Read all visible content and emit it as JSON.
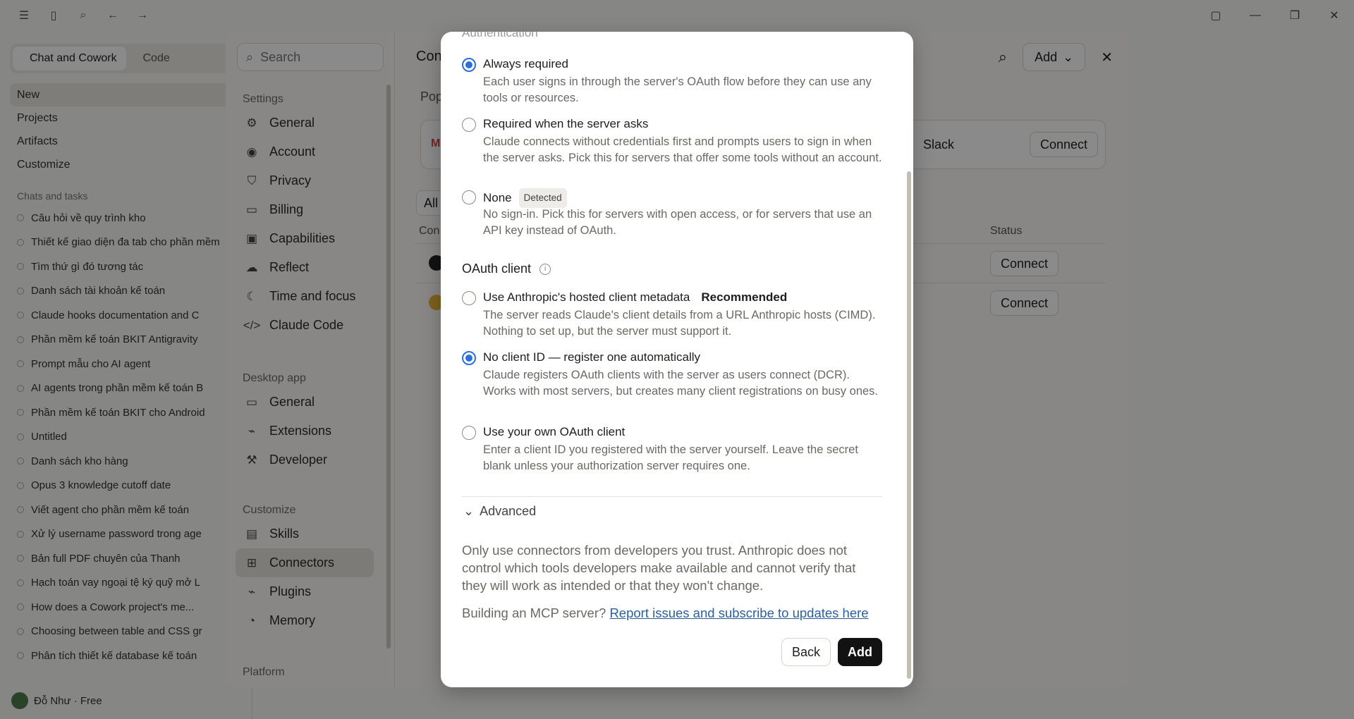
{
  "app": {
    "mode_tabs": [
      "Chat and Cowork",
      "Code"
    ],
    "nav": [
      "New",
      "Projects",
      "Artifacts",
      "Customize"
    ],
    "chats_header": "Chats and tasks",
    "chats": [
      "Câu hỏi về quy trình kho",
      "Thiết kế giao diện đa tab cho phần mềm",
      "Tìm thứ gì đó tương tác",
      "Danh sách tài khoản kế toán",
      "Claude hooks documentation and C",
      "Phần mềm kế toán BKIT Antigravity",
      "Prompt mẫu cho AI agent",
      "AI agents trong phần mềm kế toán B",
      "Phần mềm kế toán BKIT cho Android",
      "Untitled",
      "Danh sách kho hàng",
      "Opus 3 knowledge cutoff date",
      "Viết agent cho phần mềm kế toán",
      "Xử lý username password trong age",
      "Bản full PDF chuyên của Thanh",
      "Hạch toán vay ngoại tệ ký quỹ mở L",
      "How does a Cowork project's me...",
      "Choosing between table and CSS gr",
      "Phân tích thiết kế database kế toán"
    ],
    "user": "Đỗ Như · Free"
  },
  "settings": {
    "search_placeholder": "Search",
    "groups": [
      {
        "header": "Settings",
        "items": [
          "General",
          "Account",
          "Privacy",
          "Billing",
          "Capabilities",
          "Reflect",
          "Time and focus",
          "Claude Code"
        ]
      },
      {
        "header": "Desktop app",
        "items": [
          "General",
          "Extensions",
          "Developer"
        ]
      },
      {
        "header": "Customize",
        "items": [
          "Skills",
          "Connectors",
          "Plugins",
          "Memory"
        ]
      },
      {
        "header": "Platform",
        "items": []
      }
    ],
    "main": {
      "title": "Con",
      "add_label": "Add",
      "popular_label": "Pop",
      "popular_name": "Slack",
      "connect_label": "Connect",
      "filter_chip": "All",
      "col_name": "Con",
      "col_status": "Status"
    }
  },
  "modal": {
    "auth_title": "Authentication",
    "auth_options": [
      {
        "title": "Always required",
        "desc": "Each user signs in through the server's OAuth flow before they can use any tools or resources.",
        "selected": true,
        "badge": ""
      },
      {
        "title": "Required when the server asks",
        "desc": "Claude connects without credentials first and prompts users to sign in when the server asks. Pick this for servers that offer some tools without an account.",
        "selected": false,
        "badge": ""
      },
      {
        "title": "None",
        "desc": "No sign-in. Pick this for servers with open access, or for servers that use an API key instead of OAuth.",
        "selected": false,
        "badge": "Detected"
      }
    ],
    "client_title": "OAuth client",
    "client_options": [
      {
        "title": "Use Anthropic's hosted client metadata",
        "rec": "Recommended",
        "desc": "The server reads Claude's client details from a URL Anthropic hosts (CIMD). Nothing to set up, but the server must support it.",
        "selected": false
      },
      {
        "title": "No client ID — register one automatically",
        "rec": "",
        "desc": "Claude registers OAuth clients with the server as users connect (DCR). Works with most servers, but creates many client registrations on busy ones.",
        "selected": true
      },
      {
        "title": "Use your own OAuth client",
        "rec": "",
        "desc": "Enter a client ID you registered with the server yourself. Leave the secret blank unless your authorization server requires one.",
        "selected": false
      }
    ],
    "advanced_label": "Advanced",
    "warning": "Only use connectors from developers you trust. Anthropic does not control which tools developers make available and cannot verify that they will work as intended or that they won't change.",
    "build_prefix": "Building an MCP server?",
    "build_link": "Report issues and subscribe to updates here",
    "back_label": "Back",
    "add_label": "Add"
  },
  "colors": {
    "accent": "#2c6fdb",
    "link": "#2b5f9e",
    "primary_button": "#121212"
  }
}
